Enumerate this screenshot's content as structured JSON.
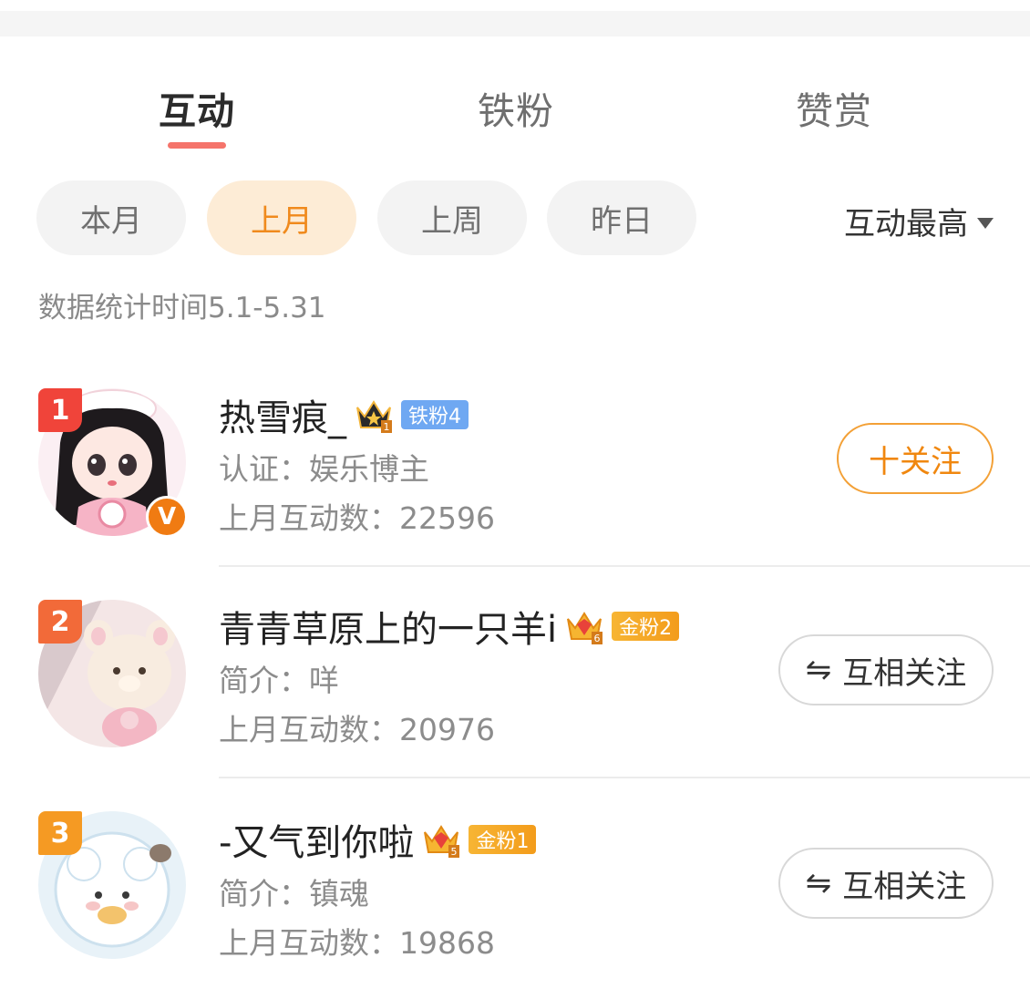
{
  "tabs": [
    {
      "label": "互动",
      "active": true
    },
    {
      "label": "铁粉",
      "active": false
    },
    {
      "label": "赞赏",
      "active": false
    }
  ],
  "filters": {
    "chips": [
      {
        "label": "本月",
        "active": false
      },
      {
        "label": "上月",
        "active": true
      },
      {
        "label": "上周",
        "active": false
      },
      {
        "label": "昨日",
        "active": false
      }
    ],
    "sort_label": "互动最高"
  },
  "stat_note": "数据统计时间5.1-5.31",
  "users": [
    {
      "rank": "1",
      "name": "热雪痕_",
      "badge": "铁粉4",
      "crown_num": "1",
      "info": "认证：娱乐博主",
      "interactions": "上月互动数：22596",
      "action": "十关注",
      "verified_mark": "V"
    },
    {
      "rank": "2",
      "name": "青青草原上的一只羊i",
      "badge": "金粉2",
      "crown_num": "6",
      "info": "简介：咩",
      "interactions": "上月互动数：20976",
      "action": "互相关注",
      "action_icon": "⇋"
    },
    {
      "rank": "3",
      "name": "-又气到你啦",
      "badge": "金粉1",
      "crown_num": "5",
      "info": "简介：镇魂",
      "interactions": "上月互动数：19868",
      "action": "互相关注",
      "action_icon": "⇋"
    }
  ],
  "colors": {
    "accent_orange": "#f08a1d",
    "tab_underline": "#f5746b",
    "iron_badge": "#6fa8f2",
    "gold_badge": "#f7b534"
  }
}
